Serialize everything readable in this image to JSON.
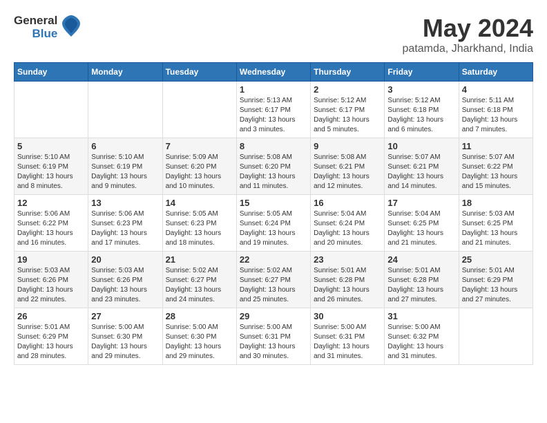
{
  "header": {
    "logo_general": "General",
    "logo_blue": "Blue",
    "month_year": "May 2024",
    "location": "patamda, Jharkhand, India"
  },
  "days_of_week": [
    "Sunday",
    "Monday",
    "Tuesday",
    "Wednesday",
    "Thursday",
    "Friday",
    "Saturday"
  ],
  "weeks": [
    [
      {
        "day": "",
        "sunrise": "",
        "sunset": "",
        "daylight": ""
      },
      {
        "day": "",
        "sunrise": "",
        "sunset": "",
        "daylight": ""
      },
      {
        "day": "",
        "sunrise": "",
        "sunset": "",
        "daylight": ""
      },
      {
        "day": "1",
        "sunrise": "Sunrise: 5:13 AM",
        "sunset": "Sunset: 6:17 PM",
        "daylight": "Daylight: 13 hours and 3 minutes."
      },
      {
        "day": "2",
        "sunrise": "Sunrise: 5:12 AM",
        "sunset": "Sunset: 6:17 PM",
        "daylight": "Daylight: 13 hours and 5 minutes."
      },
      {
        "day": "3",
        "sunrise": "Sunrise: 5:12 AM",
        "sunset": "Sunset: 6:18 PM",
        "daylight": "Daylight: 13 hours and 6 minutes."
      },
      {
        "day": "4",
        "sunrise": "Sunrise: 5:11 AM",
        "sunset": "Sunset: 6:18 PM",
        "daylight": "Daylight: 13 hours and 7 minutes."
      }
    ],
    [
      {
        "day": "5",
        "sunrise": "Sunrise: 5:10 AM",
        "sunset": "Sunset: 6:19 PM",
        "daylight": "Daylight: 13 hours and 8 minutes."
      },
      {
        "day": "6",
        "sunrise": "Sunrise: 5:10 AM",
        "sunset": "Sunset: 6:19 PM",
        "daylight": "Daylight: 13 hours and 9 minutes."
      },
      {
        "day": "7",
        "sunrise": "Sunrise: 5:09 AM",
        "sunset": "Sunset: 6:20 PM",
        "daylight": "Daylight: 13 hours and 10 minutes."
      },
      {
        "day": "8",
        "sunrise": "Sunrise: 5:08 AM",
        "sunset": "Sunset: 6:20 PM",
        "daylight": "Daylight: 13 hours and 11 minutes."
      },
      {
        "day": "9",
        "sunrise": "Sunrise: 5:08 AM",
        "sunset": "Sunset: 6:21 PM",
        "daylight": "Daylight: 13 hours and 12 minutes."
      },
      {
        "day": "10",
        "sunrise": "Sunrise: 5:07 AM",
        "sunset": "Sunset: 6:21 PM",
        "daylight": "Daylight: 13 hours and 14 minutes."
      },
      {
        "day": "11",
        "sunrise": "Sunrise: 5:07 AM",
        "sunset": "Sunset: 6:22 PM",
        "daylight": "Daylight: 13 hours and 15 minutes."
      }
    ],
    [
      {
        "day": "12",
        "sunrise": "Sunrise: 5:06 AM",
        "sunset": "Sunset: 6:22 PM",
        "daylight": "Daylight: 13 hours and 16 minutes."
      },
      {
        "day": "13",
        "sunrise": "Sunrise: 5:06 AM",
        "sunset": "Sunset: 6:23 PM",
        "daylight": "Daylight: 13 hours and 17 minutes."
      },
      {
        "day": "14",
        "sunrise": "Sunrise: 5:05 AM",
        "sunset": "Sunset: 6:23 PM",
        "daylight": "Daylight: 13 hours and 18 minutes."
      },
      {
        "day": "15",
        "sunrise": "Sunrise: 5:05 AM",
        "sunset": "Sunset: 6:24 PM",
        "daylight": "Daylight: 13 hours and 19 minutes."
      },
      {
        "day": "16",
        "sunrise": "Sunrise: 5:04 AM",
        "sunset": "Sunset: 6:24 PM",
        "daylight": "Daylight: 13 hours and 20 minutes."
      },
      {
        "day": "17",
        "sunrise": "Sunrise: 5:04 AM",
        "sunset": "Sunset: 6:25 PM",
        "daylight": "Daylight: 13 hours and 21 minutes."
      },
      {
        "day": "18",
        "sunrise": "Sunrise: 5:03 AM",
        "sunset": "Sunset: 6:25 PM",
        "daylight": "Daylight: 13 hours and 21 minutes."
      }
    ],
    [
      {
        "day": "19",
        "sunrise": "Sunrise: 5:03 AM",
        "sunset": "Sunset: 6:26 PM",
        "daylight": "Daylight: 13 hours and 22 minutes."
      },
      {
        "day": "20",
        "sunrise": "Sunrise: 5:03 AM",
        "sunset": "Sunset: 6:26 PM",
        "daylight": "Daylight: 13 hours and 23 minutes."
      },
      {
        "day": "21",
        "sunrise": "Sunrise: 5:02 AM",
        "sunset": "Sunset: 6:27 PM",
        "daylight": "Daylight: 13 hours and 24 minutes."
      },
      {
        "day": "22",
        "sunrise": "Sunrise: 5:02 AM",
        "sunset": "Sunset: 6:27 PM",
        "daylight": "Daylight: 13 hours and 25 minutes."
      },
      {
        "day": "23",
        "sunrise": "Sunrise: 5:01 AM",
        "sunset": "Sunset: 6:28 PM",
        "daylight": "Daylight: 13 hours and 26 minutes."
      },
      {
        "day": "24",
        "sunrise": "Sunrise: 5:01 AM",
        "sunset": "Sunset: 6:28 PM",
        "daylight": "Daylight: 13 hours and 27 minutes."
      },
      {
        "day": "25",
        "sunrise": "Sunrise: 5:01 AM",
        "sunset": "Sunset: 6:29 PM",
        "daylight": "Daylight: 13 hours and 27 minutes."
      }
    ],
    [
      {
        "day": "26",
        "sunrise": "Sunrise: 5:01 AM",
        "sunset": "Sunset: 6:29 PM",
        "daylight": "Daylight: 13 hours and 28 minutes."
      },
      {
        "day": "27",
        "sunrise": "Sunrise: 5:00 AM",
        "sunset": "Sunset: 6:30 PM",
        "daylight": "Daylight: 13 hours and 29 minutes."
      },
      {
        "day": "28",
        "sunrise": "Sunrise: 5:00 AM",
        "sunset": "Sunset: 6:30 PM",
        "daylight": "Daylight: 13 hours and 29 minutes."
      },
      {
        "day": "29",
        "sunrise": "Sunrise: 5:00 AM",
        "sunset": "Sunset: 6:31 PM",
        "daylight": "Daylight: 13 hours and 30 minutes."
      },
      {
        "day": "30",
        "sunrise": "Sunrise: 5:00 AM",
        "sunset": "Sunset: 6:31 PM",
        "daylight": "Daylight: 13 hours and 31 minutes."
      },
      {
        "day": "31",
        "sunrise": "Sunrise: 5:00 AM",
        "sunset": "Sunset: 6:32 PM",
        "daylight": "Daylight: 13 hours and 31 minutes."
      },
      {
        "day": "",
        "sunrise": "",
        "sunset": "",
        "daylight": ""
      }
    ]
  ]
}
